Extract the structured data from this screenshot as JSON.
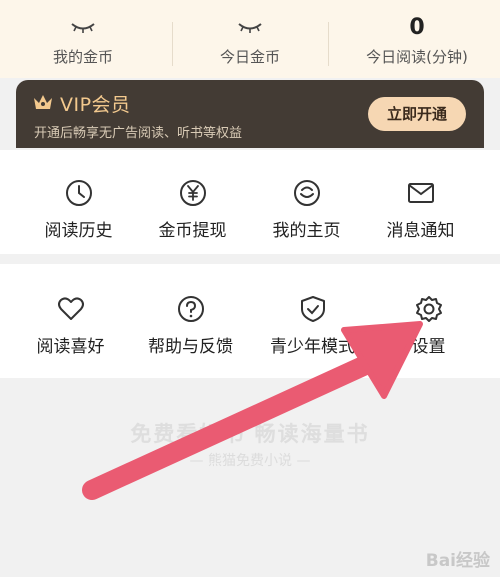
{
  "stats": {
    "my_coins": {
      "value": "",
      "label": "我的金币"
    },
    "today_coins": {
      "value": "",
      "label": "今日金币"
    },
    "today_reading": {
      "value": "0",
      "label": "今日阅读(分钟)"
    }
  },
  "vip": {
    "title": "VIP会员",
    "subtitle": "开通后畅享无广告阅读、听书等权益",
    "button": "立即开通"
  },
  "menu_row1": [
    {
      "label": "阅读历史",
      "icon": "clock-icon"
    },
    {
      "label": "金币提现",
      "icon": "yen-icon"
    },
    {
      "label": "我的主页",
      "icon": "homepage-icon"
    },
    {
      "label": "消息通知",
      "icon": "mail-icon"
    }
  ],
  "menu_row2": [
    {
      "label": "阅读喜好",
      "icon": "heart-icon"
    },
    {
      "label": "帮助与反馈",
      "icon": "help-icon"
    },
    {
      "label": "青少年模式",
      "icon": "shield-icon"
    },
    {
      "label": "设置",
      "icon": "gear-icon"
    }
  ],
  "promo": {
    "main": "免费看好书 畅读海量书",
    "sub": "— 熊猫免费小说 —"
  },
  "watermark": "Bai经验",
  "colors": {
    "vip_bg": "#433b34",
    "vip_gold": "#f3c98e",
    "vip_button": "#f6d7b3",
    "annotation_arrow": "#ea5b72"
  }
}
